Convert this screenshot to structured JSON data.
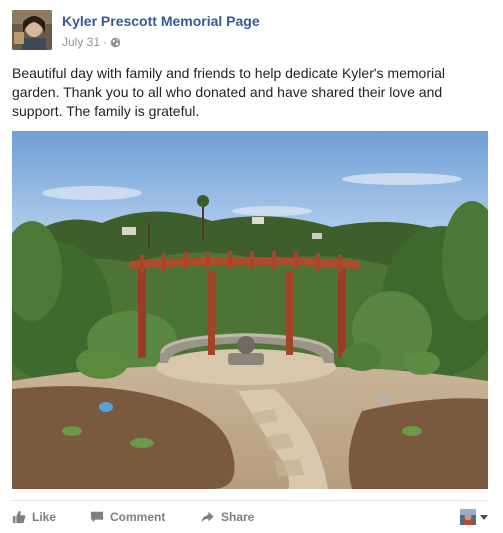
{
  "post": {
    "page_name": "Kyler Prescott Memorial Page",
    "date": "July 31",
    "separator": "·",
    "privacy_icon": "globe-icon",
    "text": "Beautiful day with family and friends to help dedicate Kyler's memorial garden. Thank you to all who donated and have shared their love and support. The family is grateful.",
    "photo_icon": "memorial-garden-photo"
  },
  "actions": {
    "like_label": "Like",
    "comment_label": "Comment",
    "share_label": "Share",
    "like_icon": "thumbs-up-icon",
    "comment_icon": "speech-bubble-icon",
    "share_icon": "share-arrow-icon"
  },
  "colors": {
    "link_blue": "#365899",
    "meta_gray": "#90949c",
    "action_gray": "#7f7f7f",
    "text": "#1d2129"
  }
}
